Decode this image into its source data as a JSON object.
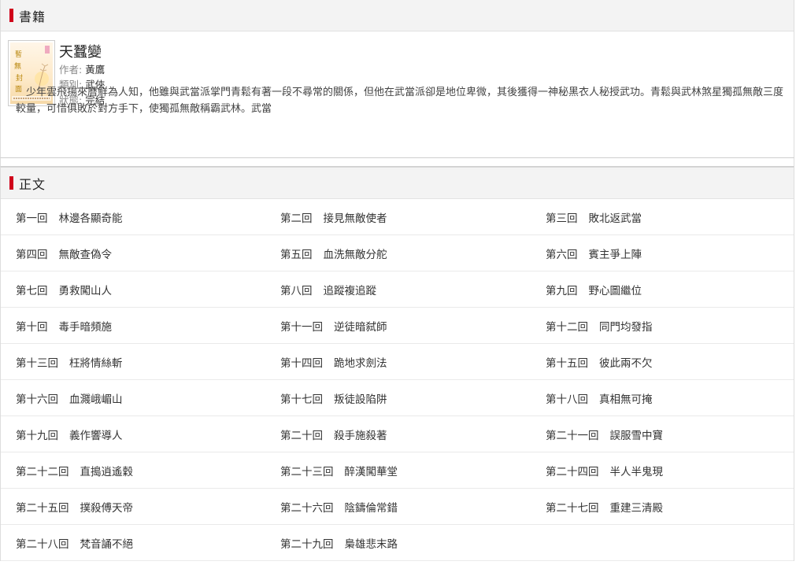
{
  "book_section": {
    "title": "書籍",
    "book": {
      "name": "天蠶變",
      "author_label": "作者:",
      "author": "黃鷹",
      "genre_label": "類別:",
      "genre": "武俠",
      "status_label": "狀態:",
      "status": "完結",
      "summary": "少年雲飛揚來曆鮮為人知，他雖與武當派掌門青鬆有著一段不尋常的關係，但他在武當派卻是地位卑微，其後獲得一神秘黑衣人秘授武功。青鬆與武林煞星獨孤無敵三度較量，可惜俱敗於對方手下，使獨孤無敵稱霸武林。武當"
    }
  },
  "chapters_section": {
    "title": "正文",
    "chapters": [
      {
        "num": "第一回",
        "name": "林邊各顯奇能"
      },
      {
        "num": "第二回",
        "name": "接見無敵使者"
      },
      {
        "num": "第三回",
        "name": "敗北返武當"
      },
      {
        "num": "第四回",
        "name": "無敵查偽令"
      },
      {
        "num": "第五回",
        "name": "血洗無敵分舵"
      },
      {
        "num": "第六回",
        "name": "賓主爭上陣"
      },
      {
        "num": "第七回",
        "name": "勇救闖山人"
      },
      {
        "num": "第八回",
        "name": "追蹤複追蹤"
      },
      {
        "num": "第九回",
        "name": "野心圖繼位"
      },
      {
        "num": "第十回",
        "name": "毒手暗頻施"
      },
      {
        "num": "第十一回",
        "name": "逆徒暗弑師"
      },
      {
        "num": "第十二回",
        "name": "同門均發指"
      },
      {
        "num": "第十三回",
        "name": "枉將情絲斬"
      },
      {
        "num": "第十四回",
        "name": "跪地求劍法"
      },
      {
        "num": "第十五回",
        "name": "彼此兩不欠"
      },
      {
        "num": "第十六回",
        "name": "血濺峨嵋山"
      },
      {
        "num": "第十七回",
        "name": "叛徒設陷阱"
      },
      {
        "num": "第十八回",
        "name": "真相無可掩"
      },
      {
        "num": "第十九回",
        "name": "義作響導人"
      },
      {
        "num": "第二十回",
        "name": "殺手施殺著"
      },
      {
        "num": "第二十一回",
        "name": "誤服雪中寶"
      },
      {
        "num": "第二十二回",
        "name": "直搗逍遙穀"
      },
      {
        "num": "第二十三回",
        "name": "醉漢闖華堂"
      },
      {
        "num": "第二十四回",
        "name": "半人半鬼現"
      },
      {
        "num": "第二十五回",
        "name": "撲殺傅天帝"
      },
      {
        "num": "第二十六回",
        "name": "陰鑄倫常錯"
      },
      {
        "num": "第二十七回",
        "name": "重建三清殿"
      },
      {
        "num": "第二十八回",
        "name": "梵音誦不絕"
      },
      {
        "num": "第二十九回",
        "name": "梟雄悲末路"
      }
    ]
  },
  "icons": {
    "header_marker": "red-bar-icon",
    "cover": "book-cover-image"
  },
  "colors": {
    "accent": "#d0021b",
    "header_bg": "#f3f3f3",
    "text": "#333333",
    "label": "#888888"
  }
}
